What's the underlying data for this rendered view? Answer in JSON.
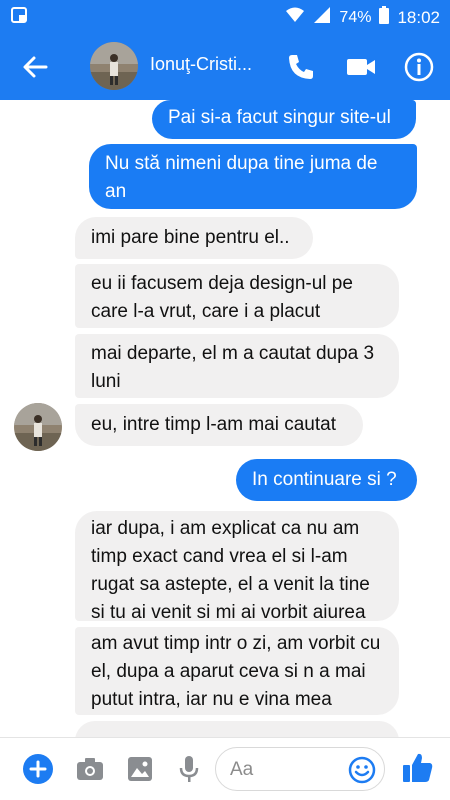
{
  "status_bar": {
    "battery": "74%",
    "time": "18:02"
  },
  "header": {
    "contact_name": "Ionuţ-Cristi...",
    "icons": [
      "back-arrow-icon",
      "phone-icon",
      "video-camera-icon",
      "info-icon"
    ]
  },
  "messages": [
    {
      "direction": "out",
      "text": "Pai si-a facut singur site-ul"
    },
    {
      "direction": "out",
      "text": "Nu stă nimeni dupa tine juma de an"
    },
    {
      "direction": "in",
      "text": "imi pare bine pentru el.."
    },
    {
      "direction": "in",
      "text": "eu ii facusem deja design-ul pe care l-a vrut, care i a placut"
    },
    {
      "direction": "in",
      "text": "mai departe, el m a cautat dupa 3 luni"
    },
    {
      "direction": "in",
      "text": "eu, intre timp l-am mai cautat"
    },
    {
      "direction": "out",
      "text": "In continuare si ?"
    },
    {
      "direction": "in",
      "text": "iar dupa, i am explicat ca nu am timp exact cand vrea el si l-am rugat sa astepte, el a venit la tine si tu ai venit si mi ai vorbit aiurea"
    },
    {
      "direction": "in",
      "text": "am avut timp intr o zi, am vorbit cu el, dupa a aparut ceva si n a mai putut intra, iar nu e vina mea"
    }
  ],
  "composer": {
    "placeholder": "Aa",
    "icons": [
      "plus-icon",
      "camera-icon",
      "image-icon",
      "microphone-icon",
      "emoji-icon",
      "thumbs-up-icon"
    ]
  },
  "colors": {
    "accent": "#1d7cf2",
    "incoming_bubble": "#f1f0f0"
  }
}
